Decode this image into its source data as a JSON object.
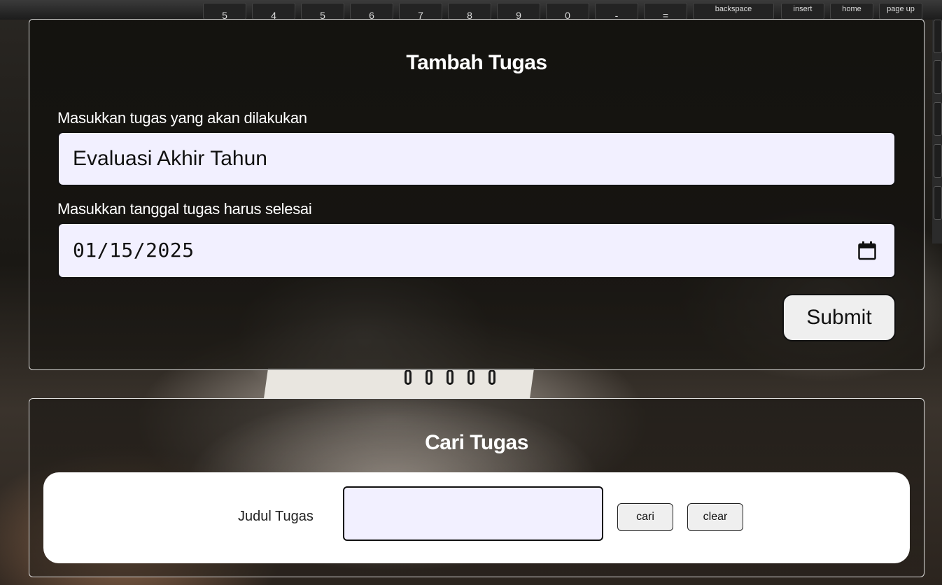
{
  "background": {
    "keyboard_keys": [
      "5",
      "4",
      "5",
      "6",
      "7",
      "8",
      "9",
      "0",
      "-",
      "=",
      "backspace",
      "insert",
      "home",
      "page up"
    ]
  },
  "add_task": {
    "title": "Tambah Tugas",
    "task_label": "Masukkan tugas yang akan dilakukan",
    "task_value": "Evaluasi Akhir Tahun",
    "date_label": "Masukkan tanggal tugas harus selesai",
    "date_value": "01/15/2025",
    "submit_label": "Submit"
  },
  "search_task": {
    "title": "Cari Tugas",
    "field_label": "Judul Tugas",
    "field_value": "",
    "search_button": "cari",
    "clear_button": "clear"
  },
  "colors": {
    "input_background": "#f2f0ff",
    "button_background": "#efefef",
    "panel_border": "#ffffff"
  },
  "icons": {
    "date_picker": "calendar-icon"
  }
}
